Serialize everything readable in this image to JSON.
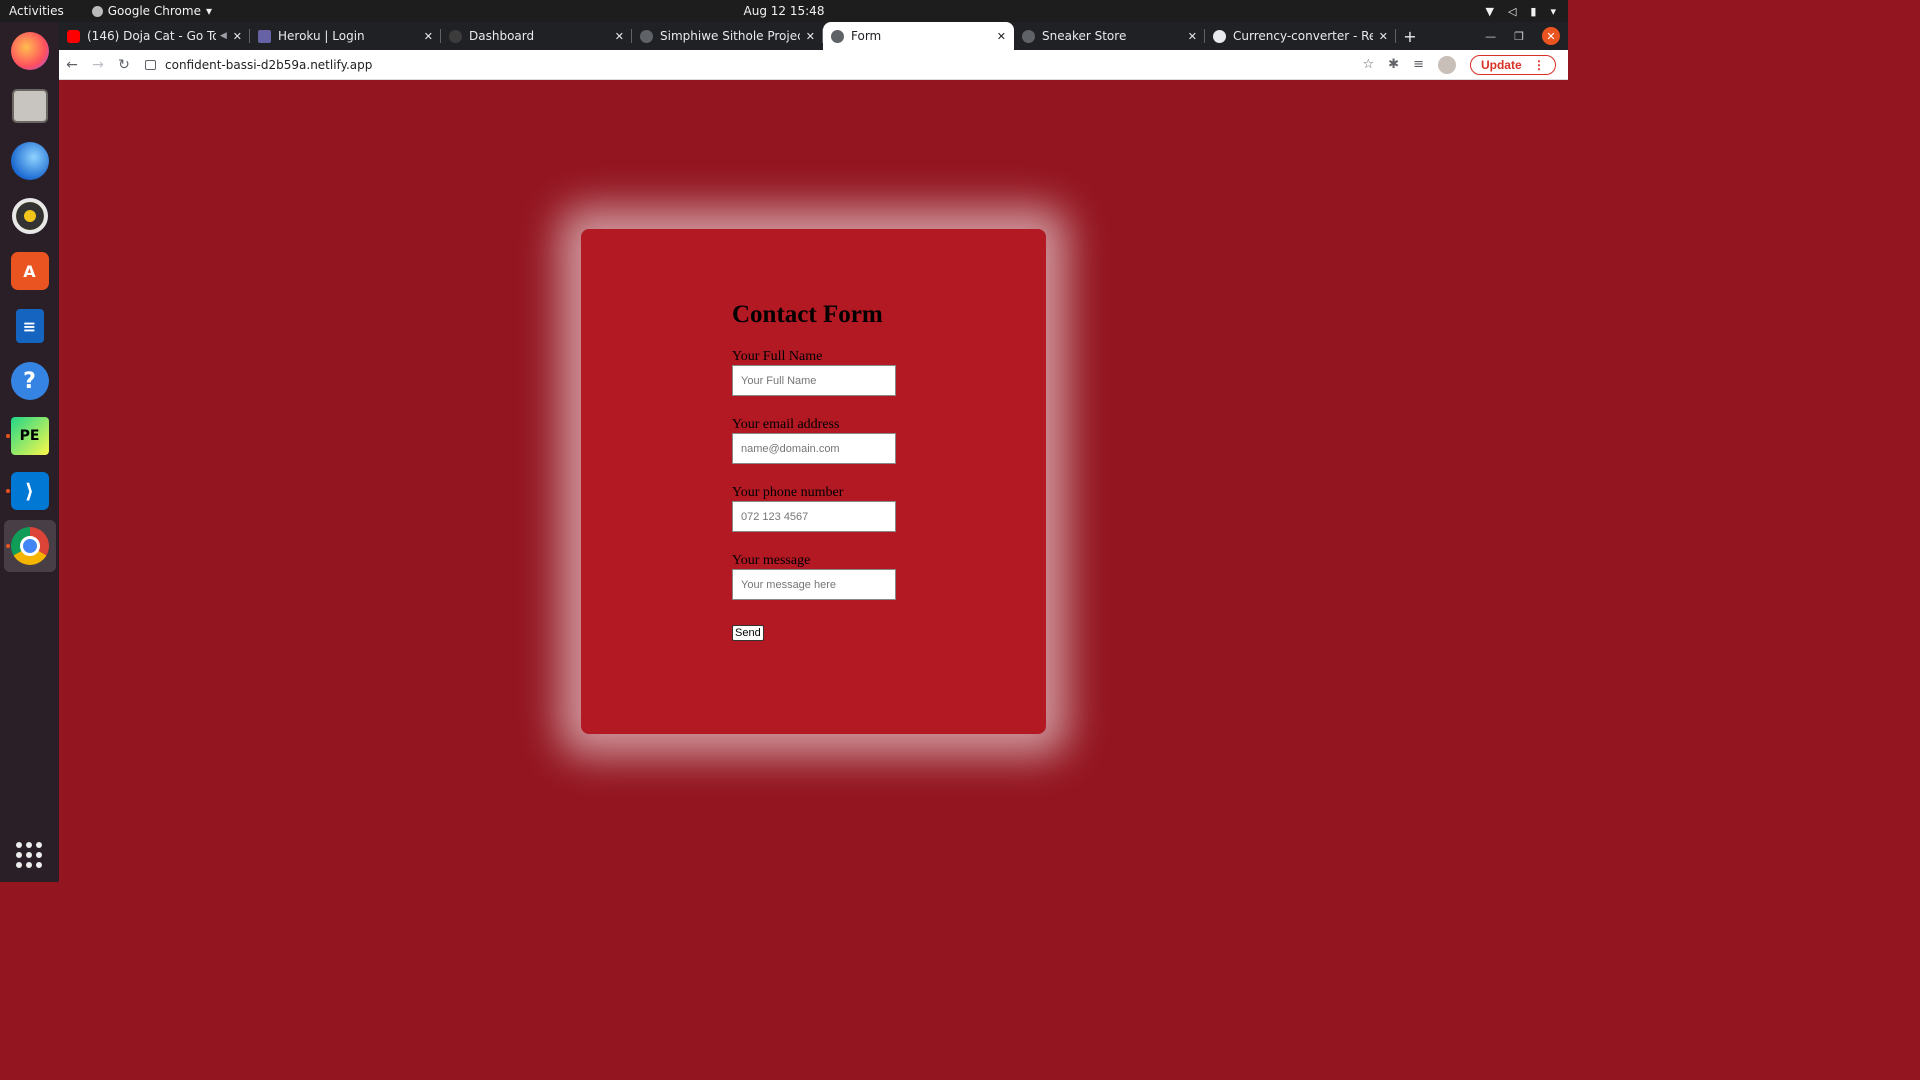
{
  "system": {
    "activities": "Activities",
    "app_name": "Google Chrome",
    "clock": "Aug 12  15:48"
  },
  "browser": {
    "tabs": [
      {
        "title": "(146) Doja Cat - Go To",
        "favicon_color": "#ff0000",
        "active": false
      },
      {
        "title": "Heroku | Login",
        "favicon_color": "#6762a6",
        "active": false
      },
      {
        "title": "Dashboard",
        "favicon_color": "#3c3c3c",
        "active": false
      },
      {
        "title": "Simphiwe Sithole Project",
        "favicon_color": "#5f6368",
        "active": false
      },
      {
        "title": "Form",
        "favicon_color": "#5f6368",
        "active": true
      },
      {
        "title": "Sneaker Store",
        "favicon_color": "#5f6368",
        "active": false
      },
      {
        "title": "Currency-converter - Rep",
        "favicon_color": "#e8eaed",
        "active": false
      }
    ],
    "url": "confident-bassi-d2b59a.netlify.app",
    "update_label": "Update"
  },
  "form": {
    "title": "Contact Form",
    "fields": [
      {
        "label": "Your Full Name",
        "placeholder": "Your Full Name"
      },
      {
        "label": "Your email address",
        "placeholder": "name@domain.com"
      },
      {
        "label": "Your phone number",
        "placeholder": "072 123 4567"
      },
      {
        "label": "Your message",
        "placeholder": "Your message here"
      }
    ],
    "submit_label": "Send"
  },
  "colors": {
    "page_background": "#931520",
    "card_background": "#b21923",
    "accent": "#e95420"
  },
  "dock": {
    "apps": [
      "firefox-icon",
      "files-icon",
      "thunderbird-icon",
      "rhythmbox-icon",
      "software-center-icon",
      "writer-icon",
      "help-icon",
      "pycharm-icon",
      "vscode-icon",
      "chrome-icon"
    ]
  }
}
